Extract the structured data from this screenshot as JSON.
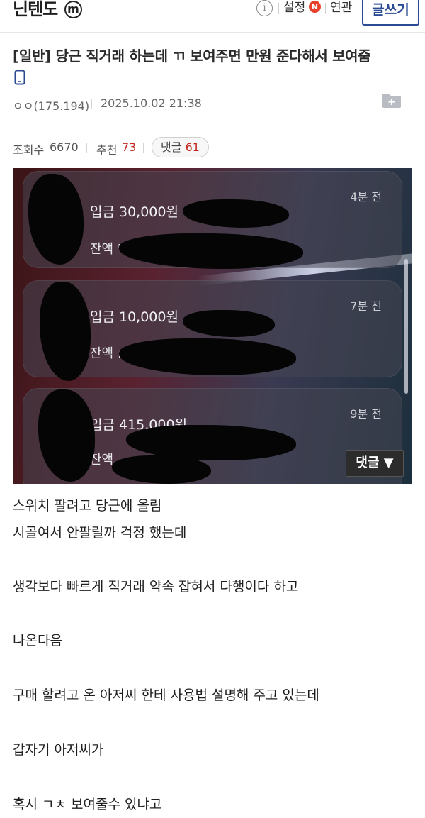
{
  "header": {
    "gallery_name": "닌텐도",
    "minor_badge": "m",
    "info_icon": "info-circle-icon",
    "settings_label": "설정",
    "new_badge": "N",
    "related_label": "연관",
    "write_button": "글쓰기"
  },
  "post": {
    "title": "[일반] 당근 직거래 하는데 ㄲ 보여주면 만원 준다해서 보여줌",
    "author": "ㅇㅇ(175.194)",
    "date": "2025.10.02 21:38",
    "views_label": "조회수",
    "views_value": "6670",
    "recommend_label": "추천",
    "recommend_value": "73",
    "comments_label": "댓글",
    "comments_value": "61"
  },
  "image": {
    "notifications": [
      {
        "time": "4분 전",
        "deposit": "입금 30,000원",
        "balance": "잔액 '"
      },
      {
        "time": "7분 전",
        "deposit": "입금 10,000원",
        "balance": "잔액 :"
      },
      {
        "time": "9분 전",
        "deposit": "입금 415,000원",
        "balance": "잔액"
      }
    ],
    "comment_button": "댓글 ▼"
  },
  "body": {
    "lines": [
      "스위치 팔려고 당근에 올림",
      "시골여서 안팔릴까 걱정 했는데",
      "생각보다 빠르게 직거래 약속 잡혀서 다행이다 하고",
      "나온다음",
      "구매 할려고 온 아저씨 한테 사용법 설명해 주고 있는데",
      "갑자기 아저씨가",
      "혹시 ㄱㅊ 보여줄수 있냐고"
    ]
  },
  "colors": {
    "accent_blue": "#2a4a93",
    "accent_red": "#c2261d",
    "badge_red": "#e8402d"
  }
}
